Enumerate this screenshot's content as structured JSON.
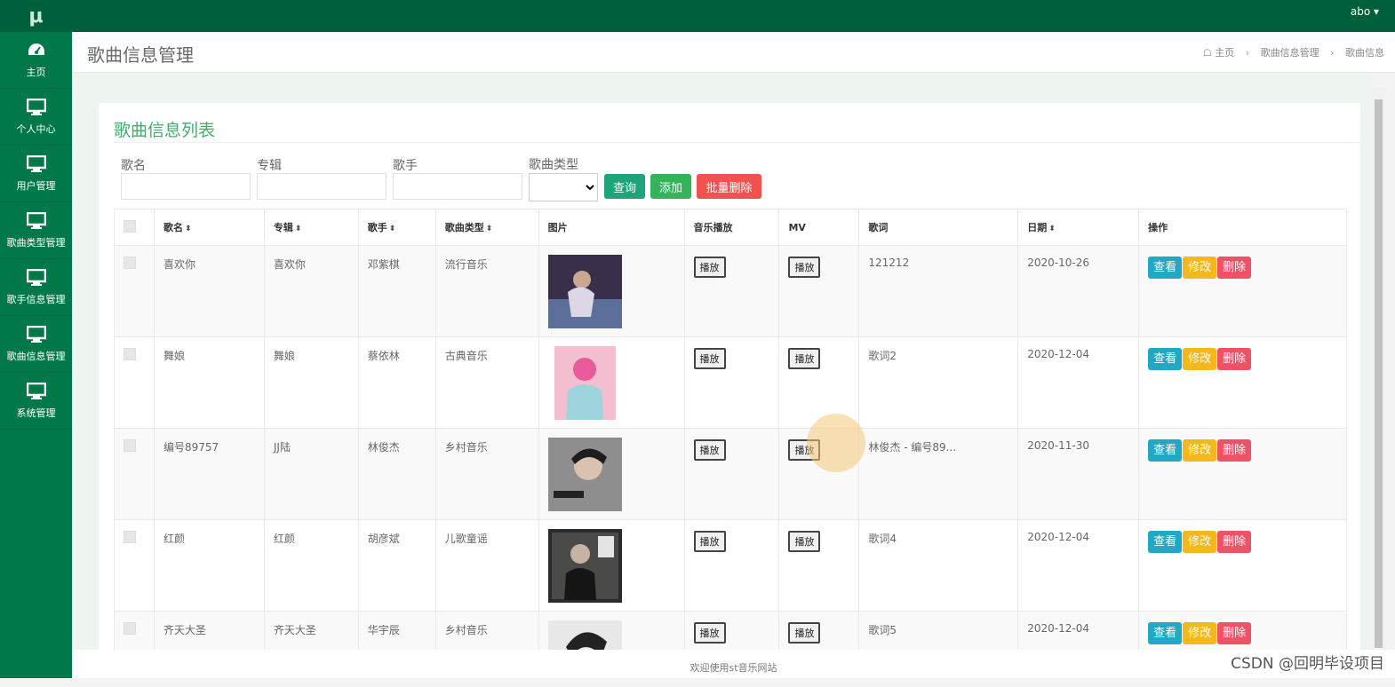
{
  "logo": "μ",
  "sidebar": {
    "items": [
      {
        "label": "主页",
        "icon": "dashboard-icon"
      },
      {
        "label": "个人中心",
        "icon": "monitor-icon"
      },
      {
        "label": "用户管理",
        "icon": "monitor-icon"
      },
      {
        "label": "歌曲类型管理",
        "icon": "monitor-icon"
      },
      {
        "label": "歌手信息管理",
        "icon": "monitor-icon"
      },
      {
        "label": "歌曲信息管理",
        "icon": "monitor-icon"
      },
      {
        "label": "系统管理",
        "icon": "monitor-icon"
      }
    ]
  },
  "topbar": {
    "user": "abo ▾"
  },
  "header": {
    "title": "歌曲信息管理",
    "breadcrumb": [
      "主页",
      "歌曲信息管理",
      "歌曲信息"
    ]
  },
  "card": {
    "title": "歌曲信息列表"
  },
  "filters": {
    "song_label": "歌名",
    "album_label": "专辑",
    "singer_label": "歌手",
    "type_label": "歌曲类型",
    "query_button": "查询",
    "add_button": "添加",
    "batch_delete_button": "批量删除"
  },
  "table": {
    "headers": [
      "歌名",
      "专辑",
      "歌手",
      "歌曲类型",
      "图片",
      "音乐播放",
      "MV",
      "歌词",
      "日期",
      "操作"
    ],
    "play_label": "播放",
    "actions": {
      "view": "查看",
      "edit": "修改",
      "delete": "删除"
    },
    "rows": [
      {
        "name": "喜欢你",
        "album": "喜欢你",
        "singer": "邓紫棋",
        "type": "流行音乐",
        "lyrics": "121212",
        "date": "2020-10-26"
      },
      {
        "name": "舞娘",
        "album": "舞娘",
        "singer": "蔡依林",
        "type": "古典音乐",
        "lyrics": "歌词2",
        "date": "2020-12-04"
      },
      {
        "name": "编号89757",
        "album": "JJ陆",
        "singer": "林俊杰",
        "type": "乡村音乐",
        "lyrics": "林俊杰 - 编号89...",
        "date": "2020-11-30"
      },
      {
        "name": "红颜",
        "album": "红颜",
        "singer": "胡彦斌",
        "type": "儿歌童谣",
        "lyrics": "歌词4",
        "date": "2020-12-04"
      },
      {
        "name": "齐天大圣",
        "album": "齐天大圣",
        "singer": "华宇辰",
        "type": "乡村音乐",
        "lyrics": "歌词5",
        "date": "2020-12-04"
      }
    ]
  },
  "footer": "欢迎使用st音乐网站",
  "watermark": "CSDN @回明毕设项目",
  "colors": {
    "sidebar": "#00784a",
    "topbar": "#00603b",
    "title_green": "#3fae6e",
    "view": "#23a8c4",
    "edit": "#f4b81c",
    "delete": "#ef5266",
    "query": "#1ab394",
    "add": "#33b35a",
    "batch_delete": "#f2524f"
  }
}
